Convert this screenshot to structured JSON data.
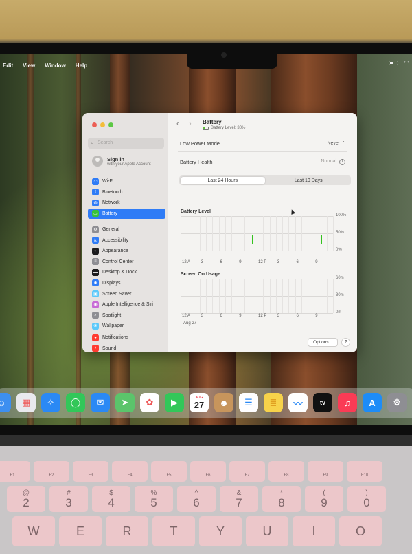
{
  "menubar": {
    "items": [
      "Edit",
      "View",
      "Window",
      "Help"
    ]
  },
  "window": {
    "search_placeholder": "Search",
    "signin_title": "Sign in",
    "signin_sub": "with your Apple Account",
    "sidebar_group1": [
      {
        "label": "Wi-Fi",
        "icon": "wifi-icon",
        "color": "#2f7cf6"
      },
      {
        "label": "Bluetooth",
        "icon": "bluetooth-icon",
        "color": "#2f7cf6"
      },
      {
        "label": "Network",
        "icon": "network-icon",
        "color": "#2f7cf6"
      },
      {
        "label": "Battery",
        "icon": "battery-icon",
        "color": "#38c13a",
        "active": true
      }
    ],
    "sidebar_group2": [
      {
        "label": "General",
        "icon": "gear-icon",
        "color": "#8e8e93"
      },
      {
        "label": "Accessibility",
        "icon": "accessibility-icon",
        "color": "#2f7cf6"
      },
      {
        "label": "Appearance",
        "icon": "appearance-icon",
        "color": "#1c1c1e"
      },
      {
        "label": "Control Center",
        "icon": "control-center-icon",
        "color": "#8e8e93"
      },
      {
        "label": "Desktop & Dock",
        "icon": "desktop-dock-icon",
        "color": "#1c1c1e"
      },
      {
        "label": "Displays",
        "icon": "displays-icon",
        "color": "#2f7cf6"
      },
      {
        "label": "Screen Saver",
        "icon": "screen-saver-icon",
        "color": "#5ac8fa"
      },
      {
        "label": "Apple Intelligence & Siri",
        "icon": "siri-icon",
        "color": "#c86bd6"
      },
      {
        "label": "Spotlight",
        "icon": "spotlight-icon",
        "color": "#8e8e93"
      },
      {
        "label": "Wallpaper",
        "icon": "wallpaper-icon",
        "color": "#5ac8fa"
      }
    ],
    "sidebar_group3": [
      {
        "label": "Notifications",
        "icon": "notifications-icon",
        "color": "#ff3b30"
      },
      {
        "label": "Sound",
        "icon": "sound-icon",
        "color": "#ff3b30"
      }
    ],
    "title": "Battery",
    "subtitle": "Battery Level: 30%",
    "low_power_label": "Low Power Mode",
    "low_power_value": "Never",
    "health_label": "Battery Health",
    "health_value": "Normal",
    "seg_options": [
      "Last 24 Hours",
      "Last 10 Days"
    ],
    "options_label": "Options...",
    "help_label": "?"
  },
  "chart_data": [
    {
      "type": "bar",
      "title": "Battery Level",
      "x": [
        "12 A",
        "3",
        "6",
        "9",
        "12 P",
        "3",
        "6",
        "9"
      ],
      "y_ticks": [
        "100%",
        "50%",
        "0%"
      ],
      "ylim": [
        0,
        100
      ],
      "bars": [
        {
          "position": 0.47,
          "value": 30
        },
        {
          "position": 0.92,
          "value": 30
        }
      ],
      "bar_color": "#35c21f"
    },
    {
      "type": "bar",
      "title": "Screen On Usage",
      "x": [
        "12 A",
        "3",
        "6",
        "9",
        "12 P",
        "3",
        "6",
        "9"
      ],
      "y_ticks": [
        "60m",
        "30m",
        "0m"
      ],
      "ylim": [
        0,
        60
      ],
      "date_label": "Aug 27",
      "bars": []
    }
  ],
  "dock": {
    "calendar_month": "AUG",
    "calendar_day": "27",
    "apps": [
      {
        "icon": "finder-icon",
        "color": "#3d8ff0"
      },
      {
        "icon": "launchpad-icon",
        "color": "#e9e9ee"
      },
      {
        "icon": "safari-icon",
        "color": "#2a89f5"
      },
      {
        "icon": "messages-icon",
        "color": "#32c759"
      },
      {
        "icon": "mail-icon",
        "color": "#2a89f5"
      },
      {
        "icon": "maps-icon",
        "color": "#5bc46b"
      },
      {
        "icon": "photos-icon",
        "color": "#ffffff"
      },
      {
        "icon": "facetime-icon",
        "color": "#32c759"
      },
      {
        "icon": "calendar-icon",
        "color": "#ffffff"
      },
      {
        "icon": "contacts-icon",
        "color": "#c7955c"
      },
      {
        "icon": "reminders-icon",
        "color": "#ffffff"
      },
      {
        "icon": "notes-icon",
        "color": "#f7d24a"
      },
      {
        "icon": "freeform-icon",
        "color": "#ffffff"
      },
      {
        "icon": "appletv-icon",
        "color": "#111111"
      },
      {
        "icon": "music-icon",
        "color": "#fa3b55"
      },
      {
        "icon": "appstore-icon",
        "color": "#1d8cf7"
      },
      {
        "icon": "system-settings-icon",
        "color": "#8e8e93"
      }
    ],
    "tv_label": "tv"
  },
  "keyboard": {
    "fn_row": [
      "F1",
      "F2",
      "F3",
      "F4",
      "F5",
      "F6",
      "F7",
      "F8",
      "F9",
      "F10"
    ],
    "num_row": [
      {
        "top": "@",
        "bot": "2"
      },
      {
        "top": "#",
        "bot": "3"
      },
      {
        "top": "$",
        "bot": "4"
      },
      {
        "top": "%",
        "bot": "5"
      },
      {
        "top": "^",
        "bot": "6"
      },
      {
        "top": "&",
        "bot": "7"
      },
      {
        "top": "*",
        "bot": "8"
      },
      {
        "top": "(",
        "bot": "9"
      },
      {
        "top": ")",
        "bot": "0"
      }
    ],
    "letter_row": [
      "W",
      "E",
      "R",
      "T",
      "Y",
      "U",
      "I",
      "O"
    ]
  }
}
